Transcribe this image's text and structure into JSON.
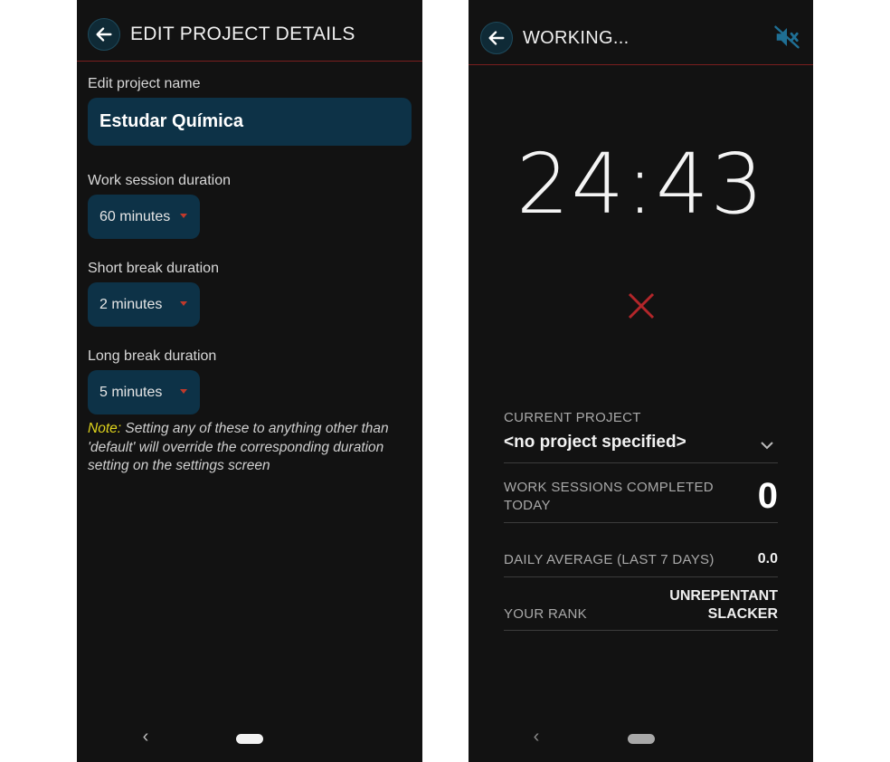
{
  "left_screen": {
    "header": {
      "title": "EDIT PROJECT DETAILS",
      "back_icon": "arrow-left-icon"
    },
    "form": {
      "name_label": "Edit project name",
      "name_value": "Estudar Química",
      "work_label": "Work session duration",
      "work_value": "60 minutes",
      "short_label": "Short break duration",
      "short_value": "2 minutes",
      "long_label": "Long break duration",
      "long_value": "5 minutes",
      "note_label": "Note:",
      "note_text": " Setting any of these to anything other than 'default' will override the corresponding duration setting on the settings screen"
    },
    "nav": {
      "back_glyph": "‹"
    }
  },
  "right_screen": {
    "header": {
      "title": "WORKING...",
      "back_icon": "arrow-left-icon",
      "mute_icon": "volume-off-icon"
    },
    "timer": "24:43",
    "cancel_icon": "close-icon",
    "current_project_label": "CURRENT PROJECT",
    "current_project_value": "<no project specified>",
    "sessions_label_line1": "WORK SESSIONS COMPLETED",
    "sessions_label_line2": "TODAY",
    "sessions_value": "0",
    "average_label": "DAILY AVERAGE (LAST 7 DAYS)",
    "average_value": "0.0",
    "rank_label": "YOUR RANK",
    "rank_value_line1": "UNREPENTANT",
    "rank_value_line2": "SLACKER",
    "nav": {
      "back_glyph": "‹"
    }
  },
  "colors": {
    "background": "#121212",
    "field": "#0d3247",
    "accent_red": "#c0392b",
    "note_yellow": "#e0d51c",
    "icon_blue": "#1f6f94"
  }
}
